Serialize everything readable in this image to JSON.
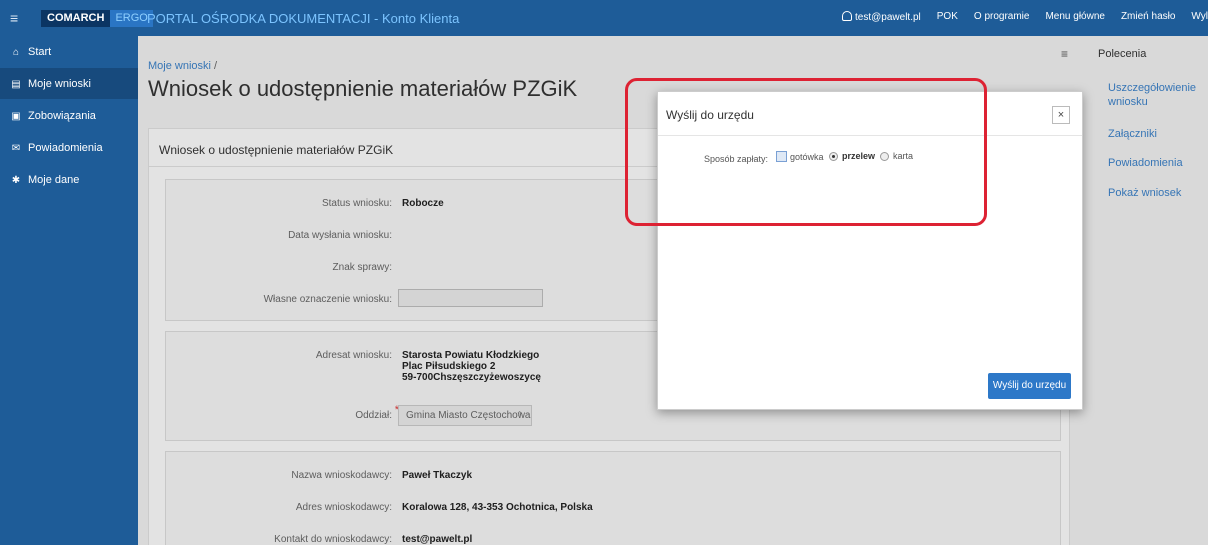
{
  "topbar": {
    "logo_primary": "COMARCH",
    "logo_secondary": "ERGO",
    "portal_title": "PORTAL OŚRODKA DOKUMENTACJI - Konto Klienta",
    "nav": [
      "test@pawelt.pl",
      "POK",
      "O programie",
      "Menu główne",
      "Zmień hasło",
      "Wyl"
    ]
  },
  "sidebar": {
    "items": [
      {
        "label": "Start",
        "icon": "home-icon"
      },
      {
        "label": "Moje wnioski",
        "icon": "document-icon",
        "active": true
      },
      {
        "label": "Zobowiązania",
        "icon": "money-icon"
      },
      {
        "label": "Powiadomienia",
        "icon": "envelope-icon"
      },
      {
        "label": "Moje dane",
        "icon": "gear-icon"
      }
    ]
  },
  "main": {
    "breadcrumb": "Moje wnioski",
    "breadcrumb_sep": "/",
    "title": "Wniosek o udostępnienie materiałów PZGiK",
    "card_title": "Wniosek o udostępnienie materiałów PZGiK",
    "status": {
      "label": "Status wniosku:",
      "value": "Robocze"
    },
    "sent_date": {
      "label": "Data wysłania wniosku:",
      "value": ""
    },
    "case_no": {
      "label": "Znak sprawy:",
      "value": ""
    },
    "own_mark": {
      "label": "Własne oznaczenie wniosku:",
      "value": ""
    },
    "addressee": {
      "label": "Adresat wniosku:",
      "line1": "Starosta Powiatu Kłodzkiego",
      "line2": "Plac Piłsudskiego 2",
      "line3": "59-700Chszęszczyżewoszycę"
    },
    "branch": {
      "label": "Oddział:",
      "required": "*",
      "value": "Gmina Miasto Częstochowa",
      "arrow": "⇕"
    },
    "applicant_name": {
      "label": "Nazwa wnioskodawcy:",
      "value": "Paweł Tkaczyk"
    },
    "applicant_address": {
      "label": "Adres wnioskodawcy:",
      "value": "Koralowa 128, 43-353 Ochotnica, Polska"
    },
    "applicant_contact": {
      "label": "Kontakt do wnioskodawcy:",
      "value": "test@pawelt.pl"
    }
  },
  "rightpanel": {
    "title": "Polecenia",
    "items": [
      "Uszczegółowienie wniosku",
      "Załączniki",
      "Powiadomienia",
      "Pokaż wniosek"
    ]
  },
  "modal": {
    "title": "Wyślij do urzędu",
    "close": "×",
    "payment_label": "Sposób zapłaty:",
    "options": [
      {
        "label": "gotówka",
        "type": "checkbox",
        "checked": false
      },
      {
        "label": "przelew",
        "type": "radio",
        "checked": true
      },
      {
        "label": "karta",
        "type": "radio",
        "checked": false
      }
    ],
    "submit": "Wyślij do urzędu"
  },
  "colors": {
    "brand": "#1e5c98",
    "accent": "#2d78c8",
    "annotation": "#dd2233"
  }
}
